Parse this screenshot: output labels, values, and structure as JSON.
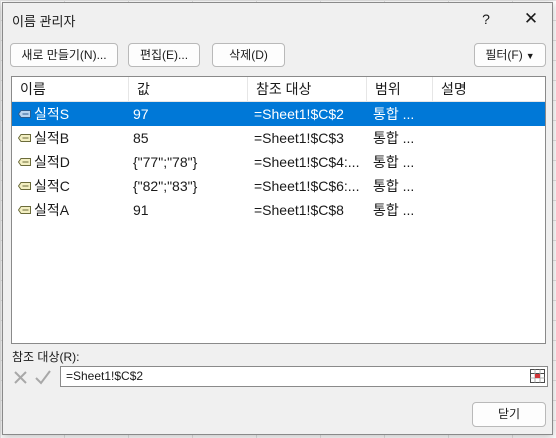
{
  "dialog": {
    "title": "이름 관리자",
    "help_label": "?",
    "close_label": "✕"
  },
  "toolbar": {
    "new_label": "새로 만들기(N)...",
    "edit_label": "편집(E)...",
    "delete_label": "삭제(D)",
    "filter_label": "필터(F)"
  },
  "table": {
    "columns": [
      "이름",
      "값",
      "참조 대상",
      "범위",
      "설명"
    ],
    "rows": [
      {
        "name": "실적S",
        "value": "97",
        "ref": "=Sheet1!$C$2",
        "scope": "통합 ...",
        "desc": "",
        "selected": true
      },
      {
        "name": "실적B",
        "value": "85",
        "ref": "=Sheet1!$C$3",
        "scope": "통합 ...",
        "desc": ""
      },
      {
        "name": "실적D",
        "value": "{\"77\";\"78\"}",
        "ref": "=Sheet1!$C$4:...",
        "scope": "통합 ...",
        "desc": ""
      },
      {
        "name": "실적C",
        "value": "{\"82\";\"83\"}",
        "ref": "=Sheet1!$C$6:...",
        "scope": "통합 ...",
        "desc": ""
      },
      {
        "name": "실적A",
        "value": "91",
        "ref": "=Sheet1!$C$8",
        "scope": "통합 ...",
        "desc": ""
      }
    ]
  },
  "refers_to": {
    "label": "참조 대상(R):",
    "value": "=Sheet1!$C$2"
  },
  "footer": {
    "close_button_label": "닫기"
  },
  "icons": {
    "name_tag": "name-tag-icon",
    "cancel": "x-icon",
    "confirm": "check-icon",
    "range_picker": "range-picker-icon",
    "dropdown": "caret-down-icon"
  },
  "colors": {
    "selection": "#0078d7",
    "dialog_bg": "#f0f0f0"
  }
}
